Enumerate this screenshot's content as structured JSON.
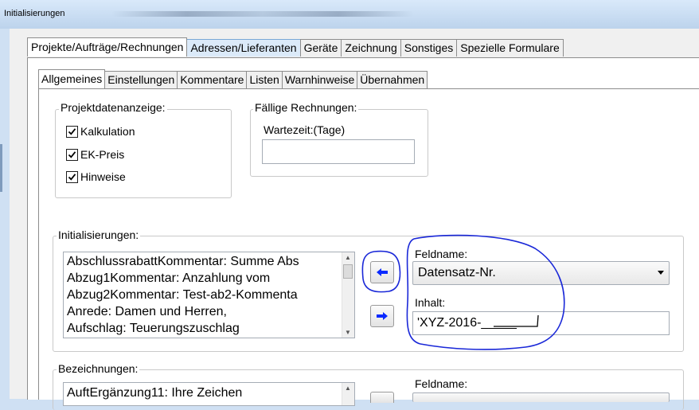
{
  "window": {
    "title": "Initialisierungen"
  },
  "main_tabs": [
    "Projekte/Aufträge/Rechnungen",
    "Adressen/Lieferanten",
    "Geräte",
    "Zeichnung",
    "Sonstiges",
    "Spezielle Formulare"
  ],
  "sub_tabs": [
    "Allgemeines",
    "Einstellungen",
    "Kommentare",
    "Listen",
    "Warnhinweise",
    "Übernahmen"
  ],
  "projektdaten": {
    "legend": "Projektdatenanzeige:",
    "checks": [
      {
        "label": "Kalkulation",
        "checked": true
      },
      {
        "label": "EK-Preis",
        "checked": true
      },
      {
        "label": "Hinweise",
        "checked": true
      }
    ]
  },
  "faellige": {
    "legend": "Fällige Rechnungen:",
    "wartezeit_label": "Wartezeit:(Tage)",
    "wartezeit_value": ""
  },
  "initialisierungen": {
    "legend": "Initialisierungen:",
    "items": [
      "AbschlussrabattKommentar: Summe Abs",
      "Abzug1Kommentar: Anzahlung vom",
      "Abzug2Kommentar: Test-ab2-Kommenta",
      "Anrede:  Damen und Herren,",
      "Aufschlag: Teuerungszuschlag"
    ],
    "feldname_label": "Feldname:",
    "feldname_value": "Datensatz-Nr.",
    "inhalt_label": "Inhalt:",
    "inhalt_value": "'XYZ-2016-_____"
  },
  "bezeichnungen": {
    "legend": "Bezeichnungen:",
    "items": [
      "AuftErgänzung11: Ihre Zeichen"
    ],
    "feldname_label": "Feldname:"
  }
}
